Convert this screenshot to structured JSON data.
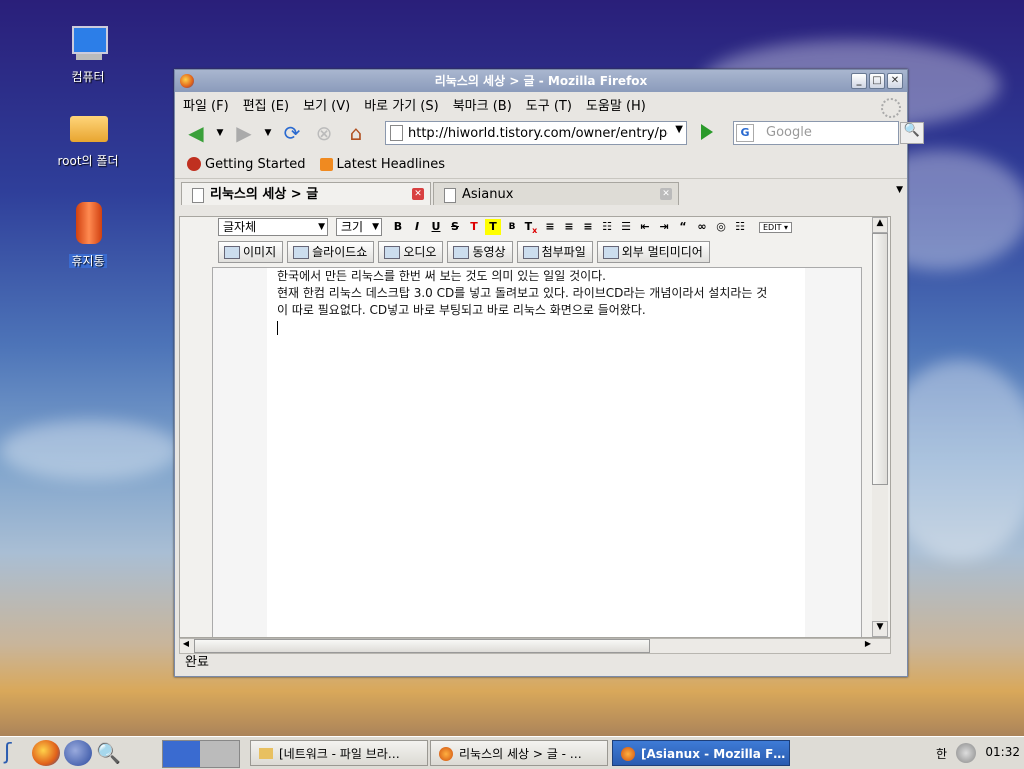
{
  "desktop": {
    "icons": [
      {
        "label": "컴퓨터"
      },
      {
        "label": "root의 폴더"
      },
      {
        "label": "휴지통"
      }
    ]
  },
  "window": {
    "title": "리눅스의 세상 > 글 - Mozilla Firefox",
    "menu": [
      "파일 (F)",
      "편집 (E)",
      "보기 (V)",
      "바로 가기 (S)",
      "북마크 (B)",
      "도구 (T)",
      "도움말 (H)"
    ],
    "url": "http://hiworld.tistory.com/owner/entry/pos",
    "search_placeholder": "Google",
    "bookmarks": [
      {
        "label": "Getting Started",
        "icon": "firefox-getting-started-icon"
      },
      {
        "label": "Latest Headlines",
        "icon": "rss-icon"
      }
    ],
    "tabs": [
      {
        "label": "리눅스의 세상 > 글",
        "active": true
      },
      {
        "label": "Asianux",
        "active": false
      }
    ],
    "status": "완료"
  },
  "editor": {
    "font_select": "글자체",
    "size_select": "크기",
    "edit_label": "EDIT",
    "media_buttons": [
      "이미지",
      "슬라이드쇼",
      "오디오",
      "동영상",
      "첨부파일",
      "외부 멀티미디어"
    ],
    "lines": [
      "한국에서 만든 리눅스를 한번 써 보는 것도 의미 있는 일일 것이다.",
      "현재 한컴 리눅스 데스크탑 3.0 CD를 넣고 돌려보고 있다. 라이브CD라는 개념이라서 설치라는 것",
      "이 따로 필요없다. CD넣고 바로 부팅되고 바로 리눅스 화면으로 들어왔다."
    ]
  },
  "taskbar": {
    "tasks": [
      {
        "label": "[네트워크 - 파일 브라…",
        "active": false
      },
      {
        "label": "리눅스의 세상 > 글 - …",
        "active": false
      },
      {
        "label": "[Asianux - Mozilla F…",
        "active": true
      }
    ],
    "ime": "한",
    "clock": "01:32"
  }
}
